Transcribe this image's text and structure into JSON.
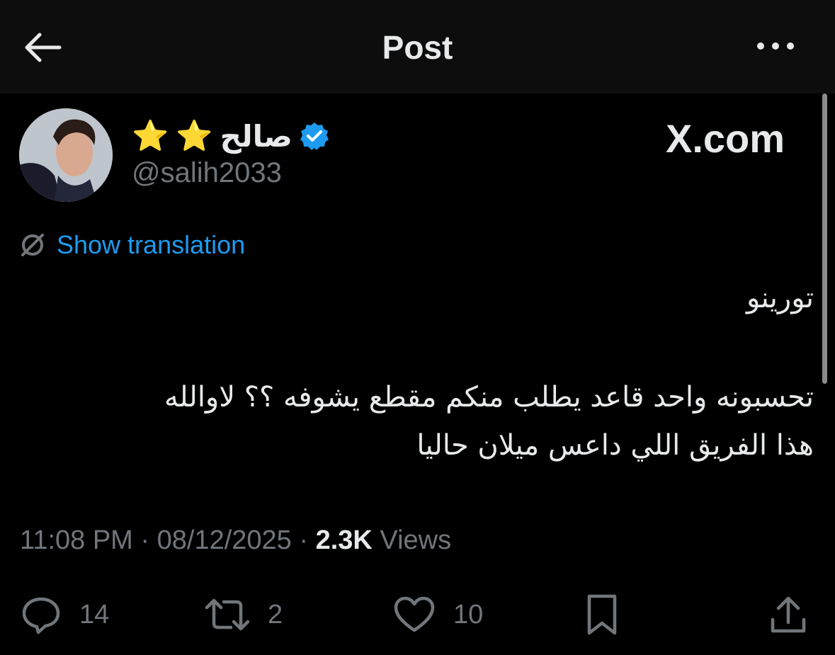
{
  "header": {
    "title": "Post"
  },
  "author": {
    "display_name": "صالح",
    "stars": [
      "⭐",
      "⭐"
    ],
    "handle": "@salih2033",
    "verified": true
  },
  "source": "X.com",
  "translation": {
    "label": "Show translation"
  },
  "tweet": {
    "lines": [
      "تورينو",
      "تحسبونه واحد قاعد يطلب منكم مقطع يشوفه  ؟؟ لاوالله",
      "هذا الفريق اللي داعس ميلان حاليا"
    ]
  },
  "meta": {
    "time": "11:08 PM",
    "separator": " · ",
    "date": "08/12/2025",
    "views_count": "2.3K",
    "views_label": " Views"
  },
  "actions": {
    "replies": "14",
    "reposts": "2",
    "likes": "10"
  },
  "colors": {
    "background": "#000000",
    "text": "#e7e9ea",
    "muted": "#71767b",
    "accent": "#1d9bf0",
    "verified": "#1d9bf0",
    "star": "#f7c52b"
  }
}
